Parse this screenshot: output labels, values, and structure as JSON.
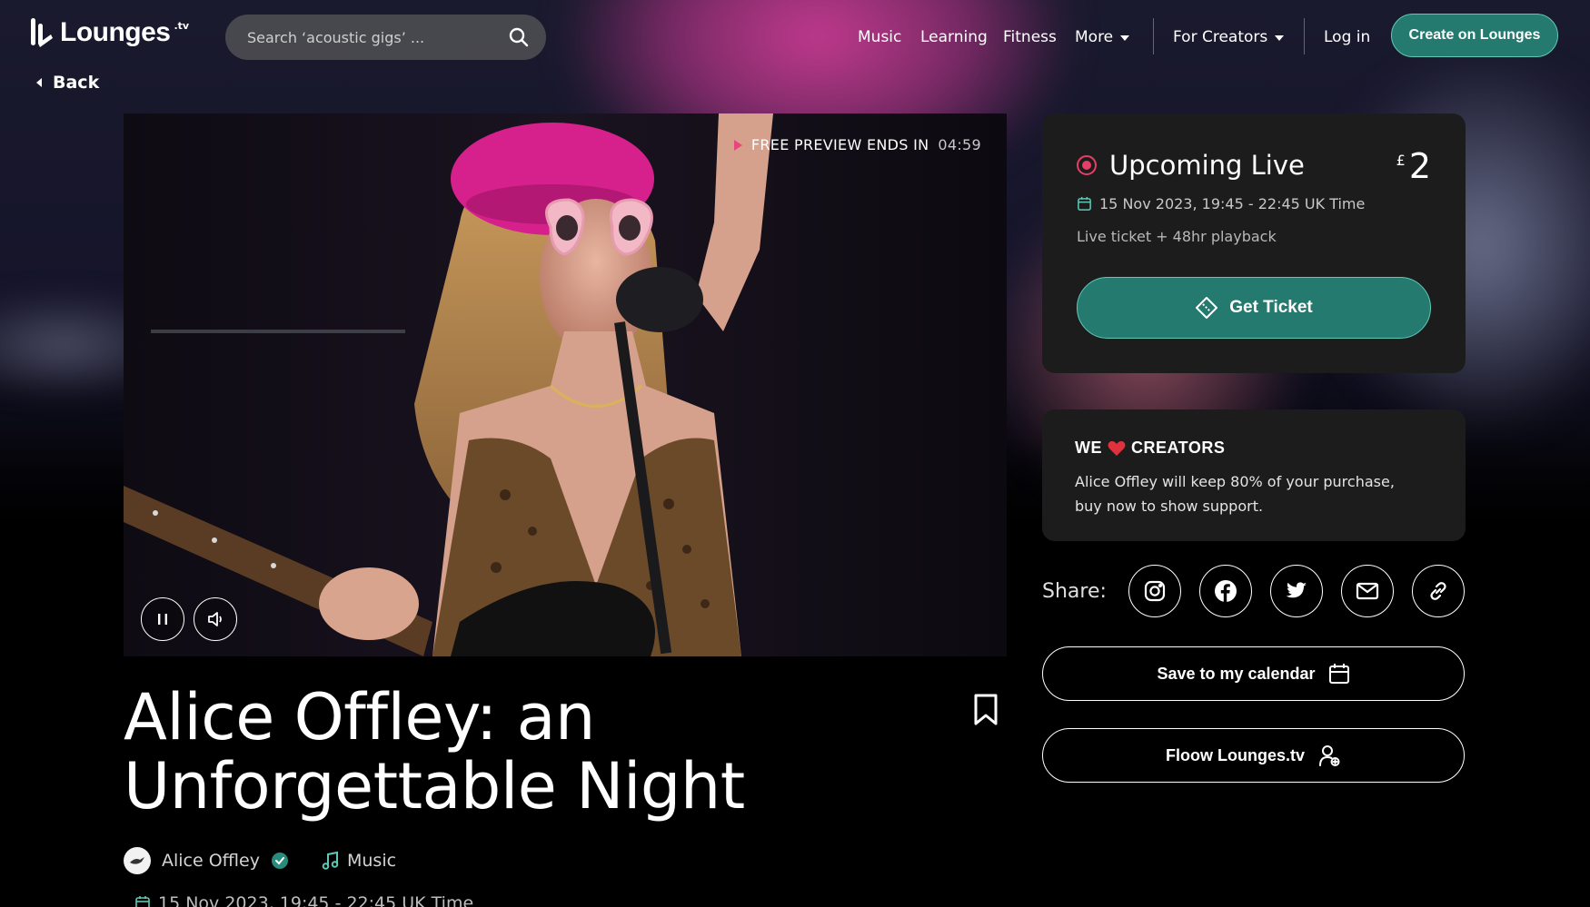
{
  "header": {
    "logo_text": "Lounges",
    "logo_suffix": ".tv",
    "search_placeholder": "Search ‘acoustic gigs’ ...",
    "nav": [
      {
        "label": "Music"
      },
      {
        "label": "Learning"
      },
      {
        "label": "Fitness"
      },
      {
        "label": "More"
      }
    ],
    "for_creators": "For Creators",
    "login": "Log in",
    "cta": "Create on Lounges"
  },
  "back_label": "Back",
  "video": {
    "preview_label": "FREE PREVIEW ENDS IN",
    "preview_time": "04:59"
  },
  "event": {
    "title": "Alice Offley: an Unforgettable Night",
    "artist": "Alice Offley",
    "category": "Music",
    "date_line": "15 Nov 2023, 19:45 - 22:45 UK Time"
  },
  "ticket_card": {
    "status": "Upcoming Live",
    "currency": "£",
    "price": "2",
    "date": "15 Nov 2023, 19:45 - 22:45 UK Time",
    "subtitle": "Live ticket + 48hr playback",
    "button": "Get Ticket"
  },
  "creators_card": {
    "heading_before": "WE",
    "heading_after": "CREATORS",
    "text": "Alice Offley will keep 80% of your purchase, buy now to show support."
  },
  "share": {
    "label": "Share:",
    "icons": [
      "instagram-icon",
      "facebook-icon",
      "twitter-icon",
      "mail-icon",
      "link-icon"
    ]
  },
  "actions": {
    "calendar": "Save to my calendar",
    "follow": "Floow Lounges.tv"
  },
  "colors": {
    "accent_teal": "#247a6e",
    "accent_teal_border": "#5fc9b6",
    "live_red": "#e63e66",
    "preview_pink": "#e8467c",
    "card_bg": "#1c1c1c"
  }
}
